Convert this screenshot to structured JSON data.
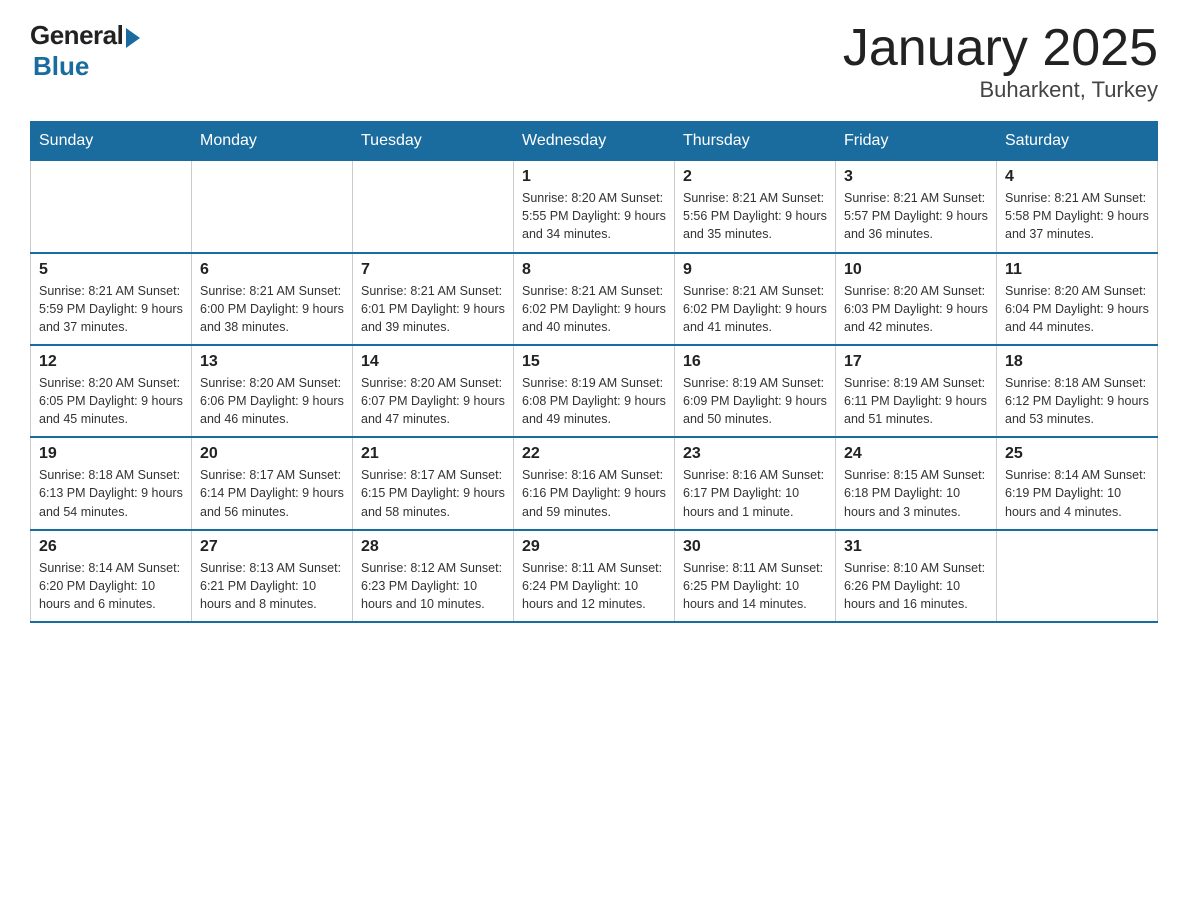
{
  "header": {
    "title": "January 2025",
    "subtitle": "Buharkent, Turkey",
    "logo_general": "General",
    "logo_blue": "Blue"
  },
  "weekdays": [
    "Sunday",
    "Monday",
    "Tuesday",
    "Wednesday",
    "Thursday",
    "Friday",
    "Saturday"
  ],
  "weeks": [
    [
      {
        "day": "",
        "info": ""
      },
      {
        "day": "",
        "info": ""
      },
      {
        "day": "",
        "info": ""
      },
      {
        "day": "1",
        "info": "Sunrise: 8:20 AM\nSunset: 5:55 PM\nDaylight: 9 hours\nand 34 minutes."
      },
      {
        "day": "2",
        "info": "Sunrise: 8:21 AM\nSunset: 5:56 PM\nDaylight: 9 hours\nand 35 minutes."
      },
      {
        "day": "3",
        "info": "Sunrise: 8:21 AM\nSunset: 5:57 PM\nDaylight: 9 hours\nand 36 minutes."
      },
      {
        "day": "4",
        "info": "Sunrise: 8:21 AM\nSunset: 5:58 PM\nDaylight: 9 hours\nand 37 minutes."
      }
    ],
    [
      {
        "day": "5",
        "info": "Sunrise: 8:21 AM\nSunset: 5:59 PM\nDaylight: 9 hours\nand 37 minutes."
      },
      {
        "day": "6",
        "info": "Sunrise: 8:21 AM\nSunset: 6:00 PM\nDaylight: 9 hours\nand 38 minutes."
      },
      {
        "day": "7",
        "info": "Sunrise: 8:21 AM\nSunset: 6:01 PM\nDaylight: 9 hours\nand 39 minutes."
      },
      {
        "day": "8",
        "info": "Sunrise: 8:21 AM\nSunset: 6:02 PM\nDaylight: 9 hours\nand 40 minutes."
      },
      {
        "day": "9",
        "info": "Sunrise: 8:21 AM\nSunset: 6:02 PM\nDaylight: 9 hours\nand 41 minutes."
      },
      {
        "day": "10",
        "info": "Sunrise: 8:20 AM\nSunset: 6:03 PM\nDaylight: 9 hours\nand 42 minutes."
      },
      {
        "day": "11",
        "info": "Sunrise: 8:20 AM\nSunset: 6:04 PM\nDaylight: 9 hours\nand 44 minutes."
      }
    ],
    [
      {
        "day": "12",
        "info": "Sunrise: 8:20 AM\nSunset: 6:05 PM\nDaylight: 9 hours\nand 45 minutes."
      },
      {
        "day": "13",
        "info": "Sunrise: 8:20 AM\nSunset: 6:06 PM\nDaylight: 9 hours\nand 46 minutes."
      },
      {
        "day": "14",
        "info": "Sunrise: 8:20 AM\nSunset: 6:07 PM\nDaylight: 9 hours\nand 47 minutes."
      },
      {
        "day": "15",
        "info": "Sunrise: 8:19 AM\nSunset: 6:08 PM\nDaylight: 9 hours\nand 49 minutes."
      },
      {
        "day": "16",
        "info": "Sunrise: 8:19 AM\nSunset: 6:09 PM\nDaylight: 9 hours\nand 50 minutes."
      },
      {
        "day": "17",
        "info": "Sunrise: 8:19 AM\nSunset: 6:11 PM\nDaylight: 9 hours\nand 51 minutes."
      },
      {
        "day": "18",
        "info": "Sunrise: 8:18 AM\nSunset: 6:12 PM\nDaylight: 9 hours\nand 53 minutes."
      }
    ],
    [
      {
        "day": "19",
        "info": "Sunrise: 8:18 AM\nSunset: 6:13 PM\nDaylight: 9 hours\nand 54 minutes."
      },
      {
        "day": "20",
        "info": "Sunrise: 8:17 AM\nSunset: 6:14 PM\nDaylight: 9 hours\nand 56 minutes."
      },
      {
        "day": "21",
        "info": "Sunrise: 8:17 AM\nSunset: 6:15 PM\nDaylight: 9 hours\nand 58 minutes."
      },
      {
        "day": "22",
        "info": "Sunrise: 8:16 AM\nSunset: 6:16 PM\nDaylight: 9 hours\nand 59 minutes."
      },
      {
        "day": "23",
        "info": "Sunrise: 8:16 AM\nSunset: 6:17 PM\nDaylight: 10 hours\nand 1 minute."
      },
      {
        "day": "24",
        "info": "Sunrise: 8:15 AM\nSunset: 6:18 PM\nDaylight: 10 hours\nand 3 minutes."
      },
      {
        "day": "25",
        "info": "Sunrise: 8:14 AM\nSunset: 6:19 PM\nDaylight: 10 hours\nand 4 minutes."
      }
    ],
    [
      {
        "day": "26",
        "info": "Sunrise: 8:14 AM\nSunset: 6:20 PM\nDaylight: 10 hours\nand 6 minutes."
      },
      {
        "day": "27",
        "info": "Sunrise: 8:13 AM\nSunset: 6:21 PM\nDaylight: 10 hours\nand 8 minutes."
      },
      {
        "day": "28",
        "info": "Sunrise: 8:12 AM\nSunset: 6:23 PM\nDaylight: 10 hours\nand 10 minutes."
      },
      {
        "day": "29",
        "info": "Sunrise: 8:11 AM\nSunset: 6:24 PM\nDaylight: 10 hours\nand 12 minutes."
      },
      {
        "day": "30",
        "info": "Sunrise: 8:11 AM\nSunset: 6:25 PM\nDaylight: 10 hours\nand 14 minutes."
      },
      {
        "day": "31",
        "info": "Sunrise: 8:10 AM\nSunset: 6:26 PM\nDaylight: 10 hours\nand 16 minutes."
      },
      {
        "day": "",
        "info": ""
      }
    ]
  ]
}
